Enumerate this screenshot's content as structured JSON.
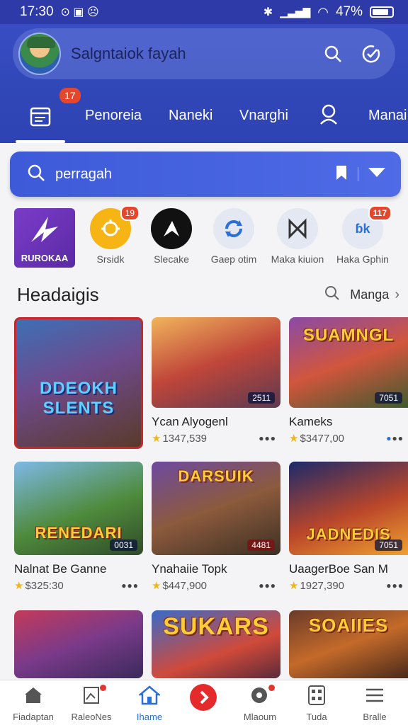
{
  "status": {
    "time": "17:30",
    "battery": "47%"
  },
  "profile": {
    "name": "Salgntaiok fayah"
  },
  "tabs": {
    "badge": "17",
    "items": [
      "Penoreia",
      "Naneki",
      "Vnarghi",
      "Manai"
    ]
  },
  "search": {
    "value": "perragah"
  },
  "shortcuts": [
    {
      "label": "RUROKAA",
      "badge": ""
    },
    {
      "label": "Srsidk",
      "badge": "19"
    },
    {
      "label": "Slecake",
      "badge": ""
    },
    {
      "label": "Gaep otim",
      "badge": ""
    },
    {
      "label": "Maka kiuion",
      "badge": ""
    },
    {
      "label": "Haka Gphin",
      "badge": "117"
    }
  ],
  "section": {
    "title": "Headaigis",
    "more": "Manga"
  },
  "games": [
    {
      "thumb_title": "DDEOKH SLENTS",
      "tag": "",
      "title": "",
      "rating": ""
    },
    {
      "thumb_title": "",
      "tag": "2511",
      "title": "Ycan Alyogenl",
      "rating": "1347,539"
    },
    {
      "thumb_title": "SUAMNGL",
      "tag": "7051",
      "title": "Kameks",
      "rating": "$3477,00"
    },
    {
      "thumb_title": "RENEDARI",
      "tag": "0031",
      "title": "Nalnat Be Ganne",
      "rating": "$325:30"
    },
    {
      "thumb_title": "DARSUIK",
      "tag": "4481",
      "title": "Ynahaiie Topk",
      "rating": "$447,900"
    },
    {
      "thumb_title": "JADNEDIS",
      "tag": "7051",
      "title": "UaagerBoe San M",
      "rating": "1927,390"
    },
    {
      "thumb_title": "",
      "tag": "",
      "title": "",
      "rating": ""
    },
    {
      "thumb_title": "SUKARS",
      "tag": "",
      "title": "",
      "rating": ""
    },
    {
      "thumb_title": "SOAIIES",
      "tag": "",
      "title": "",
      "rating": ""
    }
  ],
  "bottom_nav": [
    "Fiadaptan",
    "RaleoNes",
    "Ihame",
    "",
    "Mlaoum",
    "Tuda",
    "Bralle"
  ],
  "colors": {
    "header": "#3148b9",
    "accent": "#2c6fd6",
    "badge": "#e5472d"
  }
}
